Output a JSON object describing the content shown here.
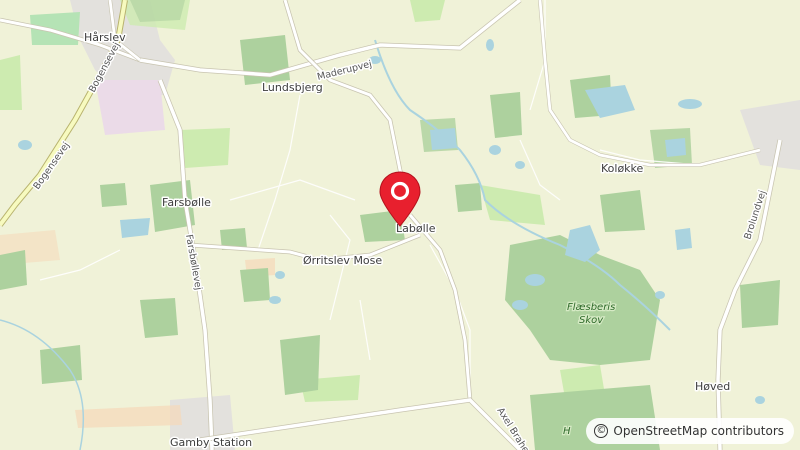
{
  "map": {
    "places": {
      "harslev": "Hårslev",
      "lundsbjerg": "Lundsbjerg",
      "farsbolle": "Farsbølle",
      "orritslev_mose": "Ørritslev Mose",
      "labolle": "Labølle",
      "kolokke": "Koløkke",
      "hoved": "Høved",
      "gamby_station": "Gamby Station"
    },
    "roads": {
      "maderupvej": "Maderupvej",
      "bogensevej_upper": "Bogensevej",
      "bogensevej_lower": "Bogensevej",
      "farsbollevej": "Farsbøllevej",
      "brolundvej": "Brolundvej",
      "axel_brahes_vej": "Axel Brahe"
    },
    "forests": {
      "flaesberis_skov_line1": "Flæsberis",
      "flaesberis_skov_line2": "Skov",
      "partial_label": "H"
    },
    "marker": {
      "location": "Labølle",
      "color": "#e8202e",
      "icon": "map-pin-icon"
    },
    "attribution": {
      "symbol": "©",
      "text": "OpenStreetMap contributors"
    },
    "colors": {
      "land": "#f0f2d8",
      "forest": "#add19e",
      "water": "#aad3df",
      "major_road": "#ffffff",
      "road_casing": "#c8c4b0",
      "primary_road": "#f7fabf",
      "primary_casing": "#b8b36e",
      "residential": "#e0dfdf",
      "industrial": "#ebdbe8"
    }
  }
}
